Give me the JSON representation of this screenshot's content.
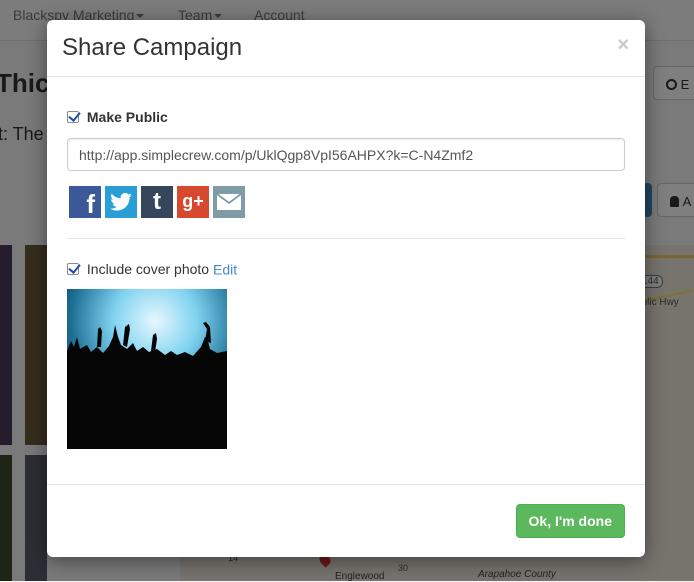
{
  "background": {
    "nav": {
      "items": [
        {
          "label": "Blackspy Marketing",
          "has_caret": true
        },
        {
          "label": "Team",
          "has_caret": true
        },
        {
          "label": "Account",
          "has_caret": false
        }
      ]
    },
    "page_title": "Thick",
    "page_subtitle": "t: The F",
    "header_button_label": "E",
    "side_button_label": "A",
    "map_labels": [
      "144",
      "ublic Hwy",
      "14",
      "30",
      "Englewood",
      "Arapahoe County"
    ]
  },
  "modal": {
    "title": "Share Campaign",
    "close_label": "×",
    "make_public": {
      "checked": true,
      "label": "Make Public"
    },
    "share_url": "http://app.simplecrew.com/p/UklQgp8VpI56AHPX?k=C-N4Zmf2",
    "share_buttons": [
      {
        "name": "facebook",
        "icon": "facebook-icon",
        "glyph": "f",
        "color": "#3b5998"
      },
      {
        "name": "twitter",
        "icon": "twitter-icon",
        "glyph": "t",
        "color": "#2a9fd6"
      },
      {
        "name": "tumblr",
        "icon": "tumblr-icon",
        "glyph": "t",
        "color": "#35465c"
      },
      {
        "name": "google-plus",
        "icon": "google-plus-icon",
        "glyph": "g+",
        "color": "#d6492f"
      },
      {
        "name": "email",
        "icon": "mail-icon",
        "glyph": "✉",
        "color": "#7f9ba5"
      }
    ],
    "cover_photo": {
      "checked": true,
      "label": "Include cover photo",
      "edit_label": "Edit"
    },
    "done_label": "Ok, I'm done"
  },
  "colors": {
    "primary_link": "#428bca",
    "success": "#5cb85c"
  }
}
